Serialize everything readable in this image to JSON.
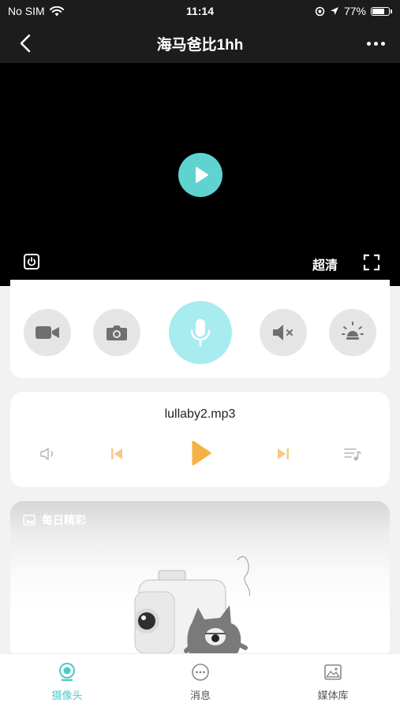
{
  "status_bar": {
    "carrier": "No SIM",
    "time": "11:14",
    "battery": "77%"
  },
  "nav": {
    "title": "海马爸比1hh"
  },
  "video": {
    "quality_label": "超清"
  },
  "player": {
    "track_name": "lullaby2.mp3"
  },
  "daily": {
    "title": "每日精彩"
  },
  "tabs": [
    {
      "label": "摄像头",
      "icon": "camera-tab-icon",
      "active": true
    },
    {
      "label": "消息",
      "icon": "message-icon",
      "active": false
    },
    {
      "label": "媒体库",
      "icon": "gallery-icon",
      "active": false
    }
  ],
  "colors": {
    "accent": "#5fd3d0",
    "mic_bg": "#a8ecef",
    "player_orange": "#f6b143",
    "player_orange_light": "#f7c887",
    "tab_active": "#4ec9c6"
  }
}
